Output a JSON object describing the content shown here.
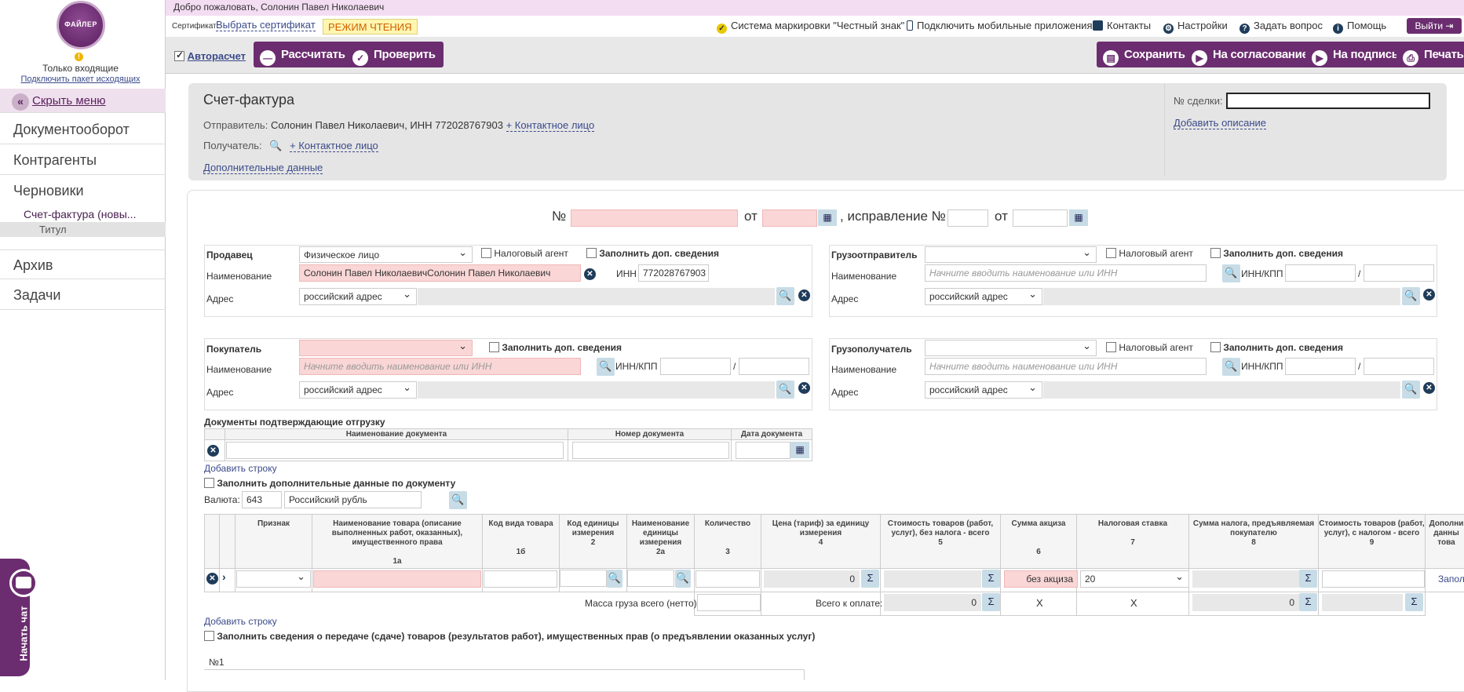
{
  "brand": {
    "logo_text": "ФАЙЛЕР"
  },
  "sidebar": {
    "only_incoming": "Только входящие",
    "connect_outgoing": "Подключить пакет исходящих",
    "hide_menu": "Скрыть меню",
    "items": [
      "Документооборот",
      "Контрагенты",
      "Черновики"
    ],
    "draft_item": "Счет-фактура (новы...",
    "draft_sub": "Титул",
    "items2": [
      "Архив",
      "Задачи"
    ],
    "chat": "Начать чат"
  },
  "topbar": {
    "welcome": "Добро пожаловать, Солонин Павел Николаевич",
    "cert_label": "Сертификат:",
    "cert_link": "Выбрать сертификат",
    "read_mode": "РЕЖИМ ЧТЕНИЯ",
    "links": [
      "Система маркировки \"Честный знак\"",
      "Подключить мобильные приложения",
      "Контакты",
      "Настройки",
      "Задать вопрос",
      "Помощь"
    ],
    "exit": "Выйти"
  },
  "toolbar": {
    "autocalc": "Авторасчет",
    "calculate": "Рассчитать",
    "check": "Проверить",
    "save": "Сохранить",
    "approve": "На согласование",
    "sign": "На подпись",
    "print": "Печать"
  },
  "header": {
    "title": "Счет-фактура",
    "sender_label": "Отправитель:",
    "sender_value": "Солонин Павел Николаевич, ИНН 772028767903",
    "contact_link": "+ Контактное лицо",
    "receiver_label": "Получатель:",
    "extra_data": "Дополнительные данные",
    "deal_label": "№ сделки:",
    "add_description": "Добавить описание"
  },
  "invoice": {
    "no_label": "№",
    "from_label": "от",
    "correction_label": ", исправление №",
    "from_label2": "от"
  },
  "seller": {
    "title": "Продавец",
    "type": "Физическое лицо",
    "tax_agent": "Налоговый агент",
    "fill_extra": "Заполнить доп. сведения",
    "name_label": "Наименование",
    "name_value": "Солонин Павел НиколаевичСолонин Павел Николаевич",
    "inn_label": "ИНН",
    "inn_value": "772028767903",
    "addr_label": "Адрес",
    "addr_type": "российский адрес"
  },
  "shipper": {
    "title": "Грузоотправитель",
    "tax_agent": "Налоговый агент",
    "fill_extra": "Заполнить доп. сведения",
    "name_label": "Наименование",
    "name_placeholder": "Начните вводить наименование или ИНН",
    "inn_kpp_label": "ИНН/КПП",
    "addr_label": "Адрес",
    "addr_type": "российский адрес"
  },
  "buyer": {
    "title": "Покупатель",
    "fill_extra": "Заполнить доп. сведения",
    "name_label": "Наименование",
    "name_placeholder": "Начните вводить наименование или ИНН",
    "inn_kpp_label": "ИНН/КПП",
    "addr_label": "Адрес",
    "addr_type": "российский адрес"
  },
  "consignee": {
    "title": "Грузополучатель",
    "tax_agent": "Налоговый агент",
    "fill_extra": "Заполнить доп. сведения",
    "name_label": "Наименование",
    "name_placeholder": "Начните вводить наименование или ИНН",
    "inn_kpp_label": "ИНН/КПП",
    "addr_label": "Адрес",
    "addr_type": "российский адрес"
  },
  "shipping_docs": {
    "title": "Документы подтверждающие отгрузку",
    "columns": [
      "Наименование документа",
      "Номер документа",
      "Дата документа"
    ],
    "add_row": "Добавить строку",
    "fill_extra_doc": "Заполнить дополнительные данные по документу"
  },
  "currency": {
    "label": "Валюта:",
    "code": "643",
    "name": "Российский рубль"
  },
  "goods": {
    "headers": [
      {
        "title": "Признак",
        "num": ""
      },
      {
        "title": "Наименование товара (описание выполненных работ, оказанных), имущественного права",
        "num": "1а"
      },
      {
        "title": "Код вида товара",
        "num": "1б"
      },
      {
        "title": "Код единицы измерения",
        "num": "2"
      },
      {
        "title": "Наименование единицы измерения",
        "num": "2а"
      },
      {
        "title": "Количество",
        "num": "3"
      },
      {
        "title": "Цена (тариф) за единицу измерения",
        "num": "4"
      },
      {
        "title": "Стоимость товаров (работ, услуг), без налога - всего",
        "num": "5"
      },
      {
        "title": "Сумма акциза",
        "num": "6"
      },
      {
        "title": "Налоговая ставка",
        "num": "7"
      },
      {
        "title": "Сумма налога, предъявляемая покупателю",
        "num": "8"
      },
      {
        "title": "Стоимость товаров (работ, услуг), с налогом - всего",
        "num": "9"
      },
      {
        "title": "Дополни данны това",
        "num": ""
      }
    ],
    "row": {
      "price": "0",
      "excise": "без акциза",
      "tax_rate": "20",
      "fill": "Запол"
    },
    "mass_label": "Масса груза всего (нетто)",
    "total_label": "Всего к оплате:",
    "total_without": "0",
    "total_tax": "0",
    "x_mark": "X",
    "add_row": "Добавить строку",
    "transfer_info": "Заполнить сведения о передаче (сдаче) товаров (результатов работ), имущественных прав (о предъявлении оказанных услуг)"
  },
  "bottom": {
    "no1": "№1"
  },
  "colors": {
    "brand": "#6b2d6f",
    "pink": "#fad6d6",
    "link": "#3a4a8a"
  }
}
